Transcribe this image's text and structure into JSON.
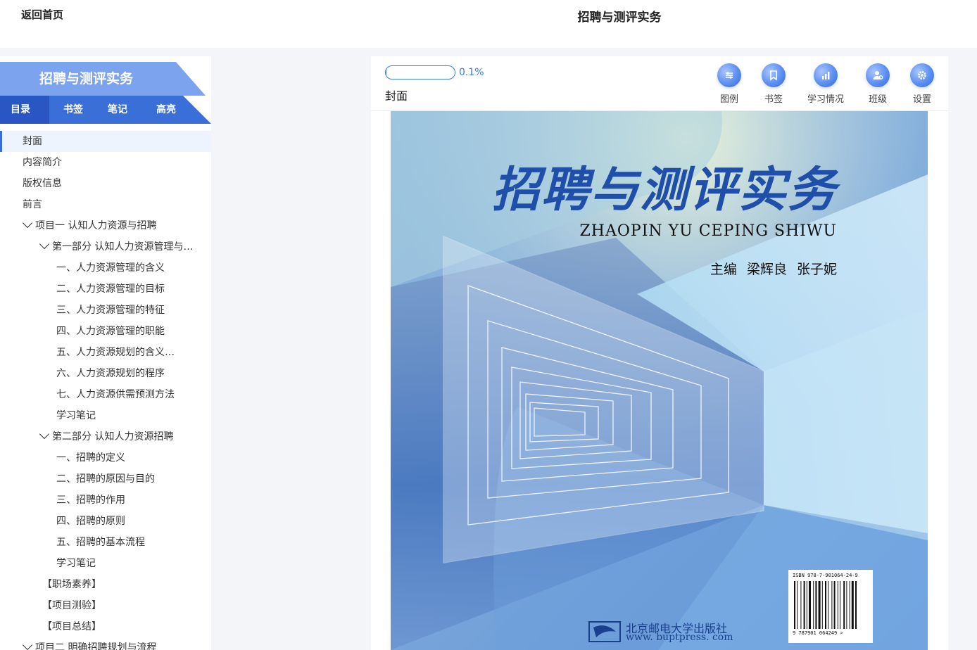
{
  "topbar": {
    "back_label": "返回首页",
    "title": "招聘与测评实务"
  },
  "sidebar": {
    "book_title": "招聘与测评实务",
    "tabs": [
      {
        "label": "目录",
        "active": true
      },
      {
        "label": "书签",
        "active": false
      },
      {
        "label": "笔记",
        "active": false
      },
      {
        "label": "高亮",
        "active": false
      }
    ],
    "toc": [
      {
        "label": "封面",
        "active": true
      },
      {
        "label": "内容简介"
      },
      {
        "label": "版权信息"
      },
      {
        "label": "前言"
      },
      {
        "label": "项目一 认知人力资源与招聘",
        "expanded": true
      },
      {
        "label": "第一部分 认知人力资源管理与…",
        "expanded": true
      },
      {
        "label": "一、人力资源管理的含义"
      },
      {
        "label": "二、人力资源管理的目标"
      },
      {
        "label": "三、人力资源管理的特征"
      },
      {
        "label": "四、人力资源管理的职能"
      },
      {
        "label": "五、人力资源规划的含义…"
      },
      {
        "label": "六、人力资源规划的程序"
      },
      {
        "label": "七、人力资源供需预测方法"
      },
      {
        "label": "学习笔记"
      },
      {
        "label": "第二部分 认知人力资源招聘",
        "expanded": true
      },
      {
        "label": "一、招聘的定义"
      },
      {
        "label": "二、招聘的原因与目的"
      },
      {
        "label": "三、招聘的作用"
      },
      {
        "label": "四、招聘的原则"
      },
      {
        "label": "五、招聘的基本流程"
      },
      {
        "label": "学习笔记"
      },
      {
        "label": "【职场素养】"
      },
      {
        "label": "【项目测验】"
      },
      {
        "label": "【项目总结】"
      },
      {
        "label": "项目二 明确招聘规划与流程",
        "expanded": true
      }
    ]
  },
  "reader": {
    "progress_value": 0.001,
    "progress_text": "0.1%",
    "section_label": "封面",
    "tools": [
      {
        "label": "图例",
        "icon": "legend-icon"
      },
      {
        "label": "书签",
        "icon": "bookmark-icon"
      },
      {
        "label": "学习情况",
        "icon": "stats-icon"
      },
      {
        "label": "班级",
        "icon": "class-icon"
      },
      {
        "label": "设置",
        "icon": "settings-icon"
      }
    ]
  },
  "cover": {
    "title": "招聘与测评实务",
    "pinyin": "ZHAOPIN YU CEPING SHIWU",
    "authors": "主编  梁辉良  张子妮",
    "publisher_name": "北京邮电大学出版社",
    "publisher_url": "www. buptpress. com",
    "isbn_top": "ISBN 978-7-901064-24-9",
    "isbn_bottom": "9 787901 064249 >"
  },
  "colors": {
    "accent": "#3a6fd8",
    "sidebar_title_bg": "#7ca3ee",
    "cover_title": "#1f4fa8"
  }
}
